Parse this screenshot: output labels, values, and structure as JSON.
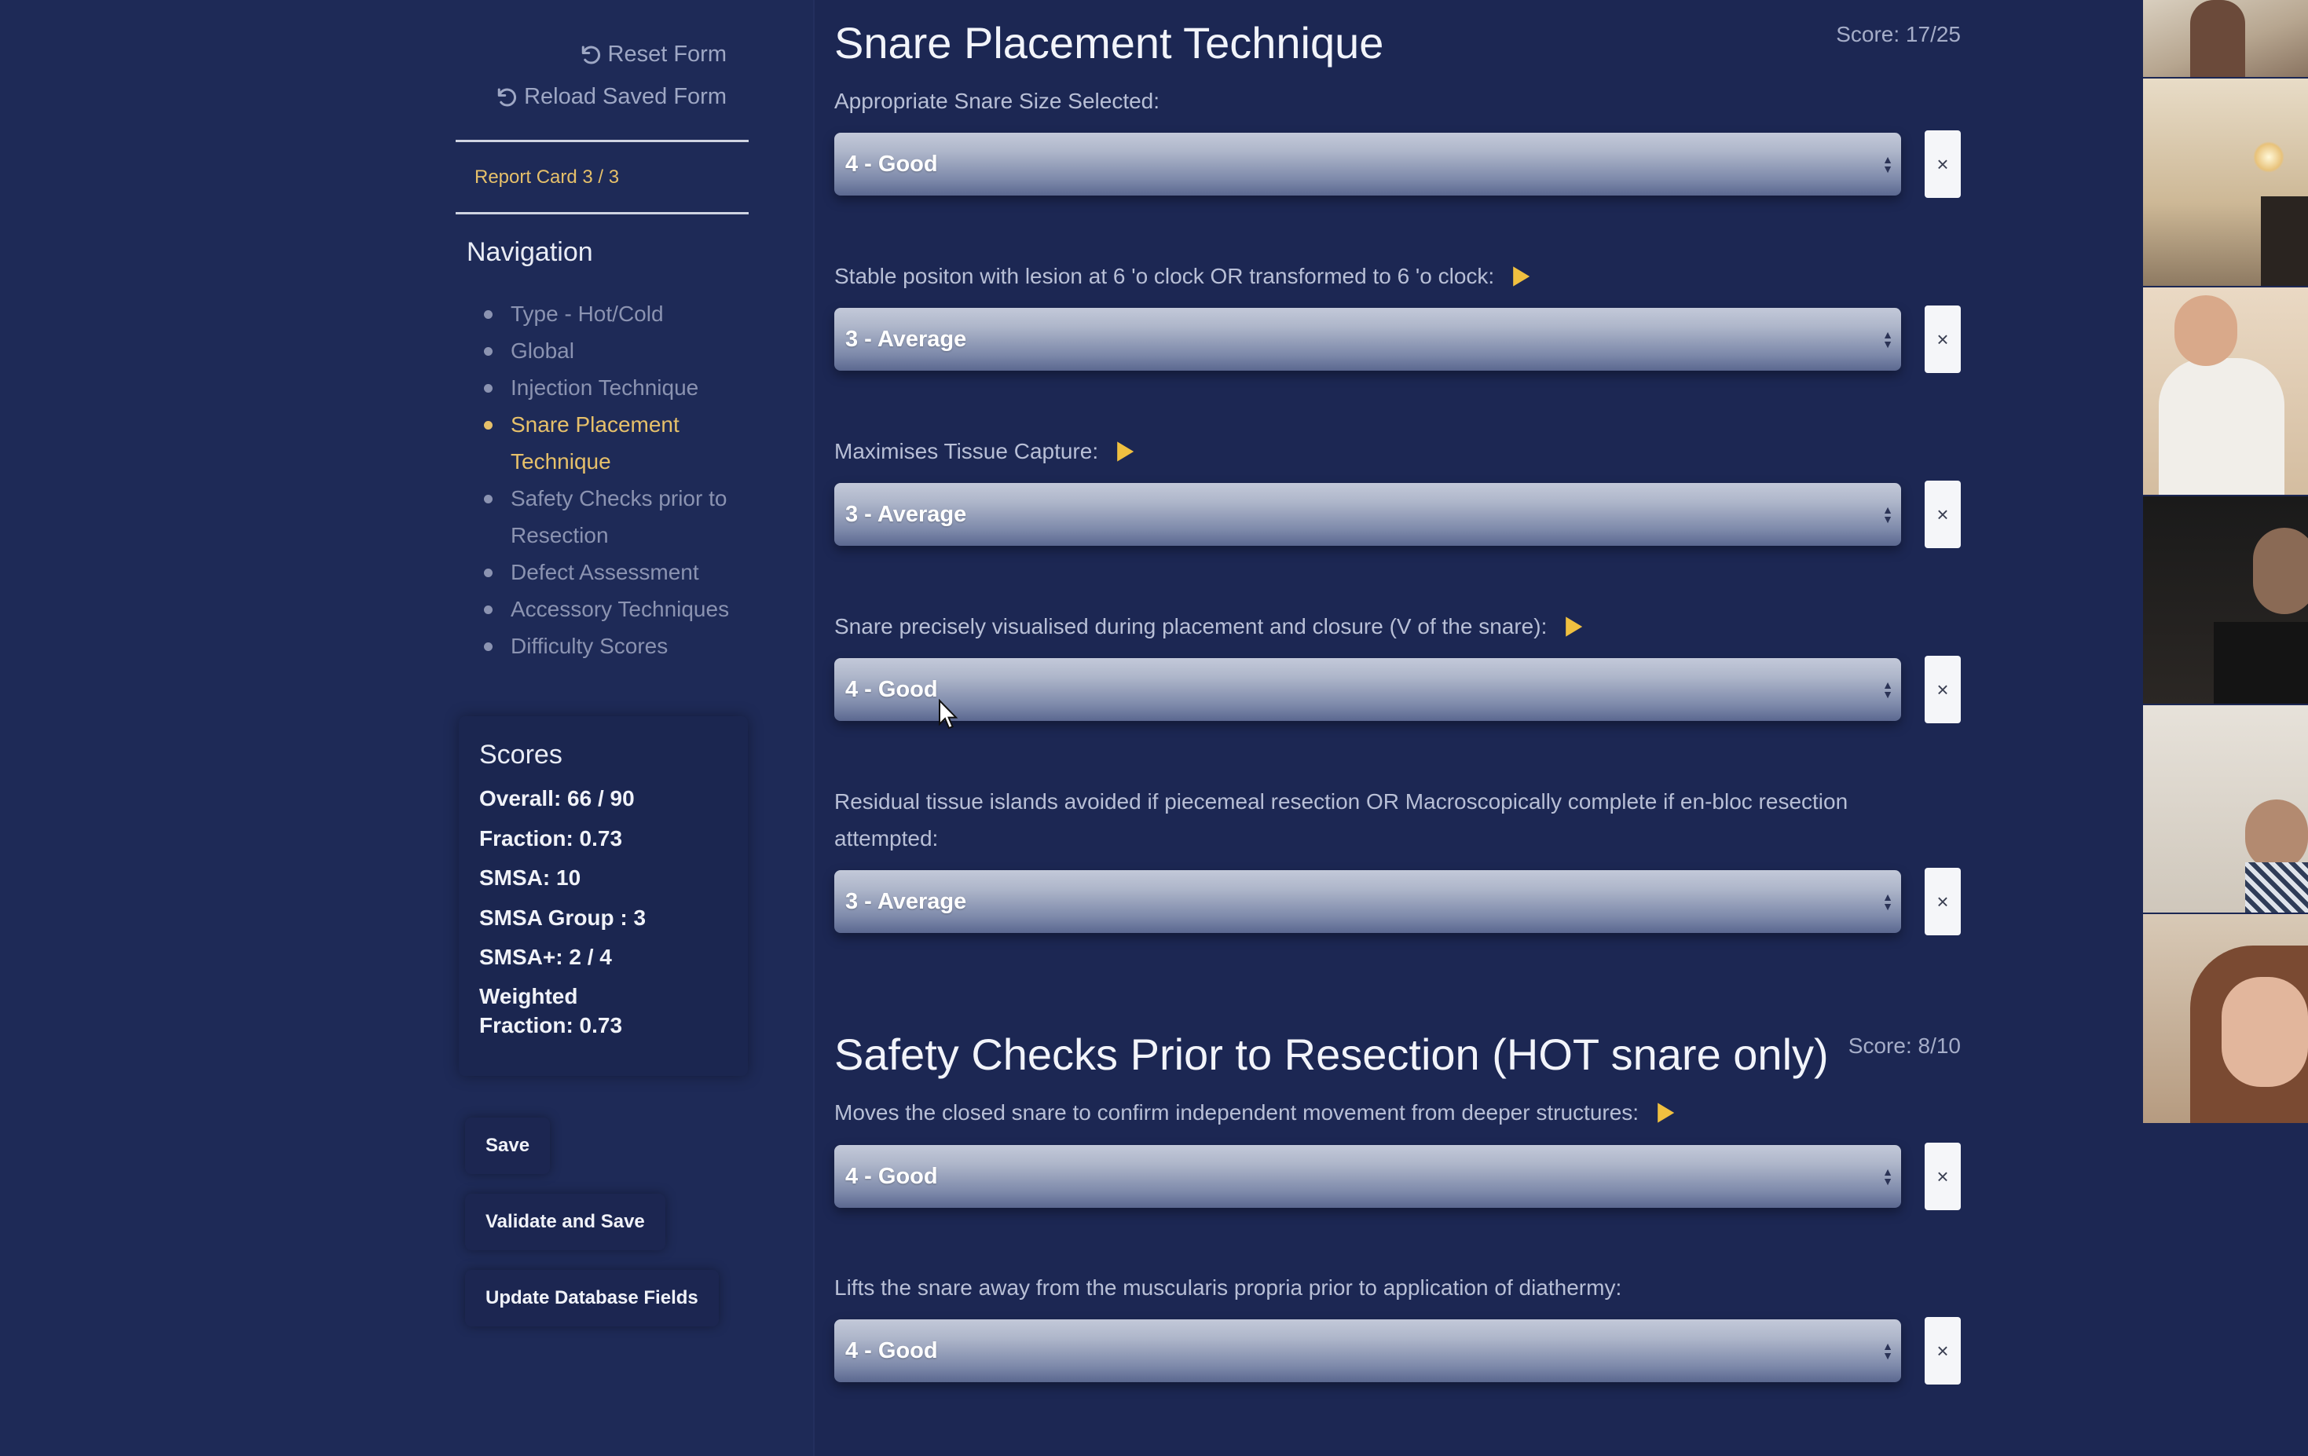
{
  "header": {
    "reset_form": "Reset Form",
    "reload_saved_form": "Reload Saved Form"
  },
  "report_card": "Report Card 3 / 3",
  "navigation": {
    "title": "Navigation",
    "items": [
      {
        "label": "Type - Hot/Cold",
        "active": false
      },
      {
        "label": "Global",
        "active": false
      },
      {
        "label": "Injection Technique",
        "active": false
      },
      {
        "label": "Snare Placement Technique",
        "active": true
      },
      {
        "label": "Safety Checks prior to Resection",
        "active": false
      },
      {
        "label": "Defect Assessment",
        "active": false
      },
      {
        "label": "Accessory Techniques",
        "active": false
      },
      {
        "label": "Difficulty Scores",
        "active": false
      }
    ]
  },
  "scores": {
    "title": "Scores",
    "overall": "Overall: 66 / 90",
    "fraction": "Fraction: 0.73",
    "smsa": "SMSA: 10",
    "smsa_group": "SMSA Group : 3",
    "smsa_plus": "SMSA+: 2 / 4",
    "weighted_line1": "Weighted",
    "weighted_line2": "Fraction: 0.73"
  },
  "actions": {
    "save": "Save",
    "validate_and_save": "Validate and Save",
    "update_database_fields": "Update Database Fields"
  },
  "sections": [
    {
      "title": "Snare Placement Technique",
      "score": "Score: 17/25",
      "questions": [
        {
          "label": "Appropriate Snare Size Selected:",
          "value": "4 - Good",
          "has_video": false
        },
        {
          "label": "Stable positon with lesion at 6 'o clock OR transformed to 6 'o clock:",
          "value": "3 - Average",
          "has_video": true
        },
        {
          "label": "Maximises Tissue Capture:",
          "value": "3 - Average",
          "has_video": true
        },
        {
          "label": "Snare precisely visualised during placement and closure (V of the snare):",
          "value": "4 - Good",
          "has_video": true
        },
        {
          "label": "Residual tissue islands avoided if piecemeal resection OR Macroscopically complete if en-bloc resection attempted:",
          "value": "3 - Average",
          "has_video": false
        }
      ]
    },
    {
      "title": "Safety Checks Prior to Resection (HOT snare only)",
      "score": "Score: 8/10",
      "questions": [
        {
          "label": "Moves the closed snare to confirm independent movement from deeper structures:",
          "value": "4 - Good",
          "has_video": true
        },
        {
          "label": "Lifts the snare away from the muscularis propria prior to application of diathermy:",
          "value": "4 - Good",
          "has_video": false
        }
      ]
    }
  ],
  "clear_symbol": "×",
  "colors": {
    "background": "#1c2753",
    "accent": "#e6c06a",
    "play_icon": "#f0c040"
  },
  "icons": {
    "reset": "undo-arrow-icon",
    "play": "play-triangle-icon",
    "clear": "close-x-icon",
    "cursor": "mouse-pointer-icon"
  }
}
